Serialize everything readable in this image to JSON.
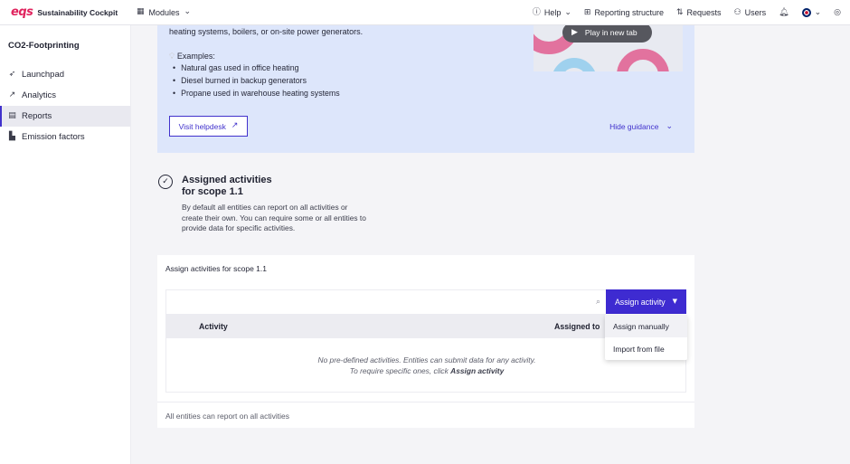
{
  "header": {
    "logo_text": "eqs",
    "app_name": "Sustainability Cockpit",
    "modules_label": "Modules",
    "nav": [
      {
        "label": "Help",
        "icon": "help-icon"
      },
      {
        "label": "Reporting structure",
        "icon": "hierarchy-icon"
      },
      {
        "label": "Requests",
        "icon": "requests-icon"
      },
      {
        "label": "Users",
        "icon": "users-icon"
      }
    ]
  },
  "sidebar": {
    "title": "CO2-Footprinting",
    "items": [
      {
        "label": "Launchpad",
        "icon": "rocket-icon",
        "active": false
      },
      {
        "label": "Analytics",
        "icon": "chart-icon",
        "active": false
      },
      {
        "label": "Reports",
        "icon": "document-icon",
        "active": true
      },
      {
        "label": "Emission factors",
        "icon": "factory-icon",
        "active": false
      }
    ]
  },
  "guidance": {
    "intro": "heating systems, boilers, or on-site power generators.",
    "examples_label": "Examples:",
    "examples": [
      "Natural gas used in office heating",
      "Diesel burned in backup generators",
      "Propane used in warehouse heating systems"
    ],
    "play_label": "Play in new tab",
    "helpdesk_label": "Visit helpdesk",
    "hide_label": "Hide guidance"
  },
  "assigned": {
    "title_line1": "Assigned activities",
    "title_line2": "for scope 1.1",
    "description": "By default all entities can report on all activities or create their own. You can require some or all entities to provide data for specific activities."
  },
  "card": {
    "title": "Assign activities for scope 1.1",
    "search_placeholder": "",
    "assign_button": "Assign activity",
    "columns": [
      "Activity",
      "Assigned to"
    ],
    "empty_line1": "No pre-defined activities. Entities can submit data for any activity.",
    "empty_line2_prefix": "To require specific ones, click ",
    "empty_line2_bold": "Assign activity",
    "footer": "All entities can report on all activities"
  },
  "dropdown": {
    "items": [
      "Assign manually",
      "Import from file"
    ]
  },
  "colors": {
    "accent": "#3e2bd1",
    "brand": "#e0245e",
    "guidance_bg": "#dde6fb"
  }
}
